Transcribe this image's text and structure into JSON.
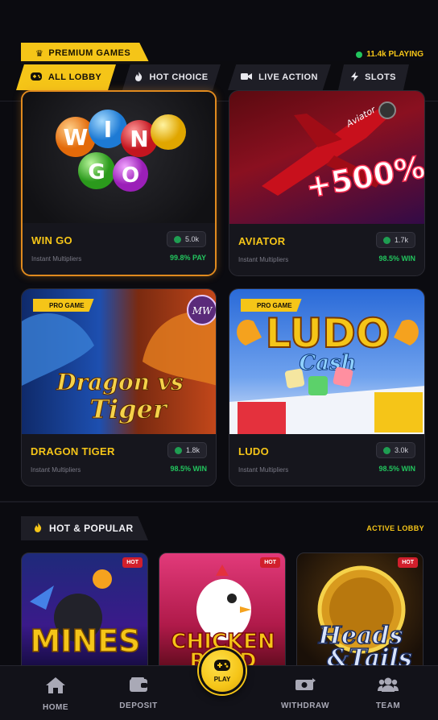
{
  "premium": {
    "title": "PREMIUM GAMES",
    "playing": "11.4k PLAYING",
    "crown_icon": "crown-icon"
  },
  "tabs": [
    {
      "label": "ALL LOBBY",
      "icon": "gamepad-icon",
      "active": true
    },
    {
      "label": "HOT CHOICE",
      "icon": "flame-icon",
      "active": false
    },
    {
      "label": "LIVE ACTION",
      "icon": "video-icon",
      "active": false
    },
    {
      "label": "SLOTS",
      "icon": "bolt-icon",
      "active": false
    }
  ],
  "games": [
    {
      "name": "WIN GO",
      "subtitle": "Instant Multipliers",
      "count": "5.0k",
      "rate": "99.8% PAY",
      "badge": "",
      "art_text": "WIN GO"
    },
    {
      "name": "AVIATOR",
      "subtitle": "Instant Multipliers",
      "count": "1.7k",
      "rate": "98.5% WIN",
      "badge": "",
      "art_text": "+500%"
    },
    {
      "name": "DRAGON TIGER",
      "subtitle": "Instant Multipliers",
      "count": "1.8k",
      "rate": "98.5% WIN",
      "badge": "PRO GAME",
      "art_text": "Dragon vs Tiger"
    },
    {
      "name": "LUDO",
      "subtitle": "Instant Multipliers",
      "count": "3.0k",
      "rate": "98.5% WIN",
      "badge": "PRO GAME",
      "art_text": "LUDO"
    }
  ],
  "hot_section": {
    "title": "HOT & POPULAR",
    "link": "ACTIVE LOBBY",
    "items": [
      {
        "badge": "HOT",
        "art_text": "MINES"
      },
      {
        "badge": "HOT",
        "art_text": "CHICKEN ROAD"
      },
      {
        "badge": "HOT",
        "art_text": "Heads & Tails"
      }
    ]
  },
  "nav": {
    "home": "HOME",
    "deposit": "DEPOSIT",
    "play": "PLAY",
    "withdraw": "WITHDRAW",
    "team": "TEAM"
  },
  "colors": {
    "accent": "#f5c518",
    "background": "#0b0b10",
    "win_green": "#22c55e",
    "hot_red": "#d11f2c",
    "selected_border": "#e08a1e"
  }
}
